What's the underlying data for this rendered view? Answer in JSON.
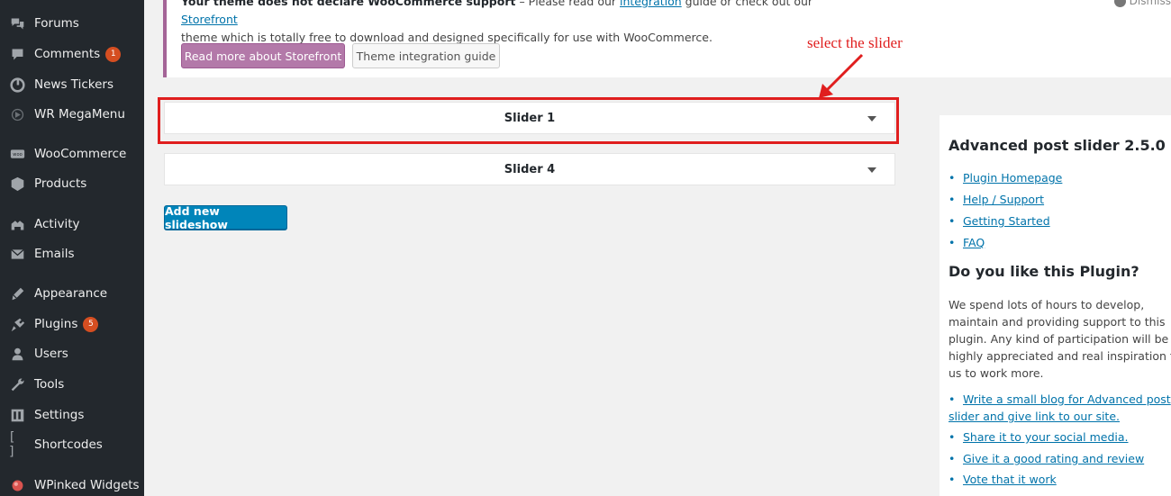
{
  "sidebar": {
    "items": [
      {
        "label": "Forums",
        "icon": "forums-icon",
        "badge": null
      },
      {
        "label": "Comments",
        "icon": "comments-icon",
        "badge": "1"
      },
      {
        "label": "News Tickers",
        "icon": "news-tickers-icon",
        "badge": null
      },
      {
        "label": "WR MegaMenu",
        "icon": "megamenu-icon",
        "badge": null
      },
      {
        "label": "WooCommerce",
        "icon": "woocommerce-icon",
        "badge": null
      },
      {
        "label": "Products",
        "icon": "products-icon",
        "badge": null
      },
      {
        "label": "Activity",
        "icon": "activity-icon",
        "badge": null
      },
      {
        "label": "Emails",
        "icon": "emails-icon",
        "badge": null
      },
      {
        "label": "Appearance",
        "icon": "appearance-icon",
        "badge": null
      },
      {
        "label": "Plugins",
        "icon": "plugins-icon",
        "badge": "5"
      },
      {
        "label": "Users",
        "icon": "users-icon",
        "badge": null
      },
      {
        "label": "Tools",
        "icon": "tools-icon",
        "badge": null
      },
      {
        "label": "Settings",
        "icon": "settings-icon",
        "badge": null
      },
      {
        "label": "Shortcodes",
        "icon": "shortcodes-icon",
        "badge": null
      },
      {
        "label": "WPinked Widgets",
        "icon": "wpinked-widgets-icon",
        "badge": null
      }
    ]
  },
  "notice": {
    "line1_bold": "Your theme does not declare WooCommerce support",
    "line1_rest": " – Please read our ",
    "integration_link": "integration",
    "line1_mid": " guide or check out our ",
    "storefront_link": "Storefront",
    "line2": "theme which is totally free to download and designed specifically for use with WooCommerce.",
    "primary_button": "Read more about Storefront",
    "secondary_button": "Theme integration guide",
    "dismiss": "Dismiss"
  },
  "annotation": {
    "label": "select the slider"
  },
  "sliders": [
    {
      "title": "Slider 1"
    },
    {
      "title": "Slider 4"
    }
  ],
  "add_button": "Add new slideshow",
  "widget": {
    "title": "Advanced post slider 2.5.0",
    "links": [
      "Plugin Homepage",
      "Help / Support",
      "Getting Started",
      "FAQ"
    ],
    "subtitle": "Do you like this Plugin?",
    "paragraph_lines": [
      "We spend lots of hours to develop,",
      "maintain and providing support to this",
      "plugin. Any kind of participation will be",
      "highly appreciated and real inspiration for",
      "us to work more."
    ],
    "blog_link_line1": "Write a small blog for Advanced post",
    "blog_link_line2": "slider and give link to our site.",
    "links2": [
      "Share it to your social media.",
      "Give it a good rating and review",
      "Vote that it work"
    ]
  },
  "colors": {
    "sidebar_bg": "#23282d",
    "badge": "#d54e21",
    "woo_purple": "#b379a9",
    "wp_blue": "#0085ba",
    "annotation_red": "#e01e1e",
    "link": "#0073aa"
  }
}
